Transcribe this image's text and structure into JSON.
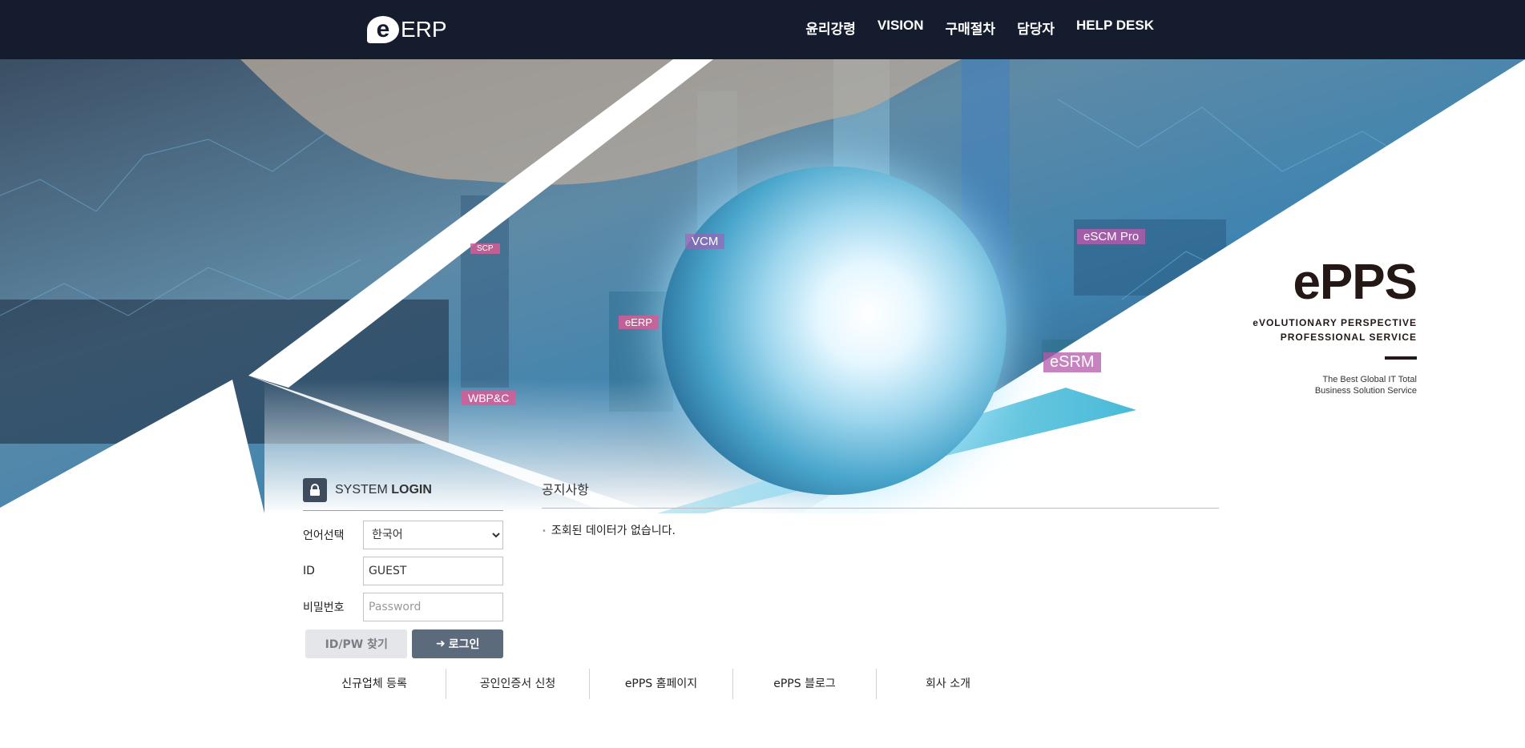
{
  "header": {
    "logo_text": "ERP",
    "nav": [
      "윤리강령",
      "VISION",
      "구매절차",
      "담당자",
      "HELP DESK"
    ]
  },
  "hero": {
    "tags": [
      "SCP",
      "eERP",
      "WBP&C",
      "eSCM Pro",
      "eSRM",
      "VCM"
    ],
    "brand": {
      "title": "ePPS",
      "sub1": "eVOLUTIONARY  PERSPECTIVE",
      "sub2": "PROFESSIONAL  SERVICE",
      "tag1": "The Best Global IT Total",
      "tag2": "Business Solution Service"
    }
  },
  "login": {
    "title_light": "SYSTEM",
    "title_bold": "LOGIN",
    "lang_label": "언어선택",
    "lang_value": "한국어",
    "id_label": "ID",
    "id_value": "GUEST",
    "pw_label": "비밀번호",
    "pw_placeholder": "Password",
    "find_button": "ID/PW 찾기",
    "login_button": "로그인"
  },
  "notice": {
    "title": "공지사항",
    "empty_message": "조회된 데이터가 없습니다."
  },
  "footer_links": [
    "신규업체 등록",
    "공인인증서 신청",
    "ePPS 홈페이지",
    "ePPS 블로그",
    "회사 소개"
  ],
  "colors": {
    "header_bg": "#141c2e",
    "login_button": "#5c6b7c",
    "find_button": "#e4e6e9",
    "tag_pink": "#d65c96"
  }
}
